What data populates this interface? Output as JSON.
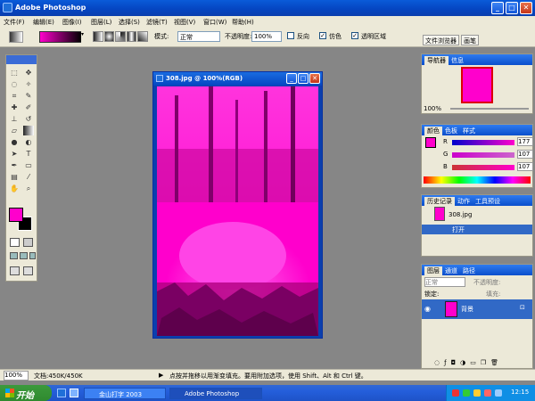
{
  "app": {
    "title": "Adobe Photoshop"
  },
  "menu": [
    "文件(F)",
    "编辑(E)",
    "图像(I)",
    "图层(L)",
    "选择(S)",
    "滤镜(T)",
    "视图(V)",
    "窗口(W)",
    "帮助(H)"
  ],
  "options": {
    "mode_label": "模式:",
    "mode_value": "正常",
    "opacity_label": "不透明度:",
    "opacity_value": "100%",
    "reverse_label": "反向",
    "dither_label": "仿色",
    "transparency_label": "透明区域",
    "dither_checked": "✓",
    "transparency_checked": "✓"
  },
  "well_tabs": [
    "文件浏览器",
    "画笔"
  ],
  "document": {
    "title": "308.jpg @ 100%(RGB)"
  },
  "navigator": {
    "tabs": [
      "导航器",
      "信息"
    ],
    "zoom": "100%"
  },
  "color_panel": {
    "tabs": [
      "颜色",
      "色板",
      "样式"
    ],
    "r_label": "R",
    "g_label": "G",
    "b_label": "B",
    "r": "177",
    "g": "107",
    "b": "107"
  },
  "history": {
    "tabs": [
      "历史记录",
      "动作",
      "工具预设"
    ],
    "snapshot": "308.jpg",
    "open_step": "打开"
  },
  "layers": {
    "tabs": [
      "图层",
      "通道",
      "路径"
    ],
    "blend_mode": "正常",
    "opacity_label": "不透明度:",
    "lock_label": "锁定:",
    "fill_label": "填充:",
    "layer_name": "背景"
  },
  "status": {
    "zoom": "100%",
    "doc_info": "文档:450K/450K",
    "hint": "点按并拖移以用渐变填充。要用附加选项，使用 Shift、Alt 和 Ctrl 键。"
  },
  "taskbar": {
    "start": "开始",
    "items": [
      "金山打字 2003",
      "Adobe Photoshop"
    ],
    "clock": "12:15"
  },
  "colors": {
    "accent": "#ff00cc",
    "titlebar": "#0546c2",
    "panel_bg": "#ece9d8",
    "canvas_bg": "#868686"
  }
}
